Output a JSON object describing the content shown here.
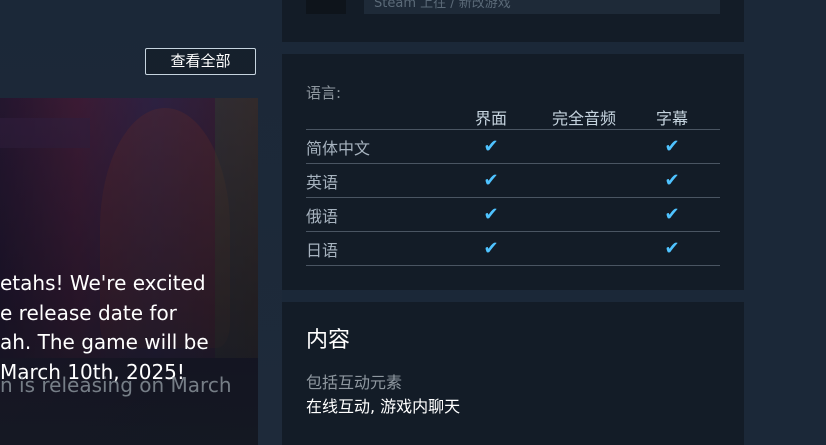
{
  "news": {
    "view_all_label": "查看全部",
    "body_lines": [
      "etahs! We're excited",
      "e release date for",
      "ah. The game will be",
      "March 10th, 2025!"
    ],
    "subtitle": "n is releasing on March"
  },
  "top_panel": {
    "text": "Steam 上往 / 新改游戏"
  },
  "languages": {
    "label": "语言:",
    "columns": [
      "界面",
      "完全音频",
      "字幕"
    ],
    "rows": [
      {
        "name": "简体中文",
        "ui": "✔",
        "audio": "",
        "subtitles": "✔"
      },
      {
        "name": "英语",
        "ui": "✔",
        "audio": "",
        "subtitles": "✔"
      },
      {
        "name": "俄语",
        "ui": "✔",
        "audio": "",
        "subtitles": "✔"
      },
      {
        "name": "日语",
        "ui": "✔",
        "audio": "",
        "subtitles": "✔"
      }
    ],
    "check_color": "#4fc3ff"
  },
  "content": {
    "title": "内容",
    "subtitle": "包括互动元素",
    "value": "在线互动, 游戏内聊天"
  }
}
